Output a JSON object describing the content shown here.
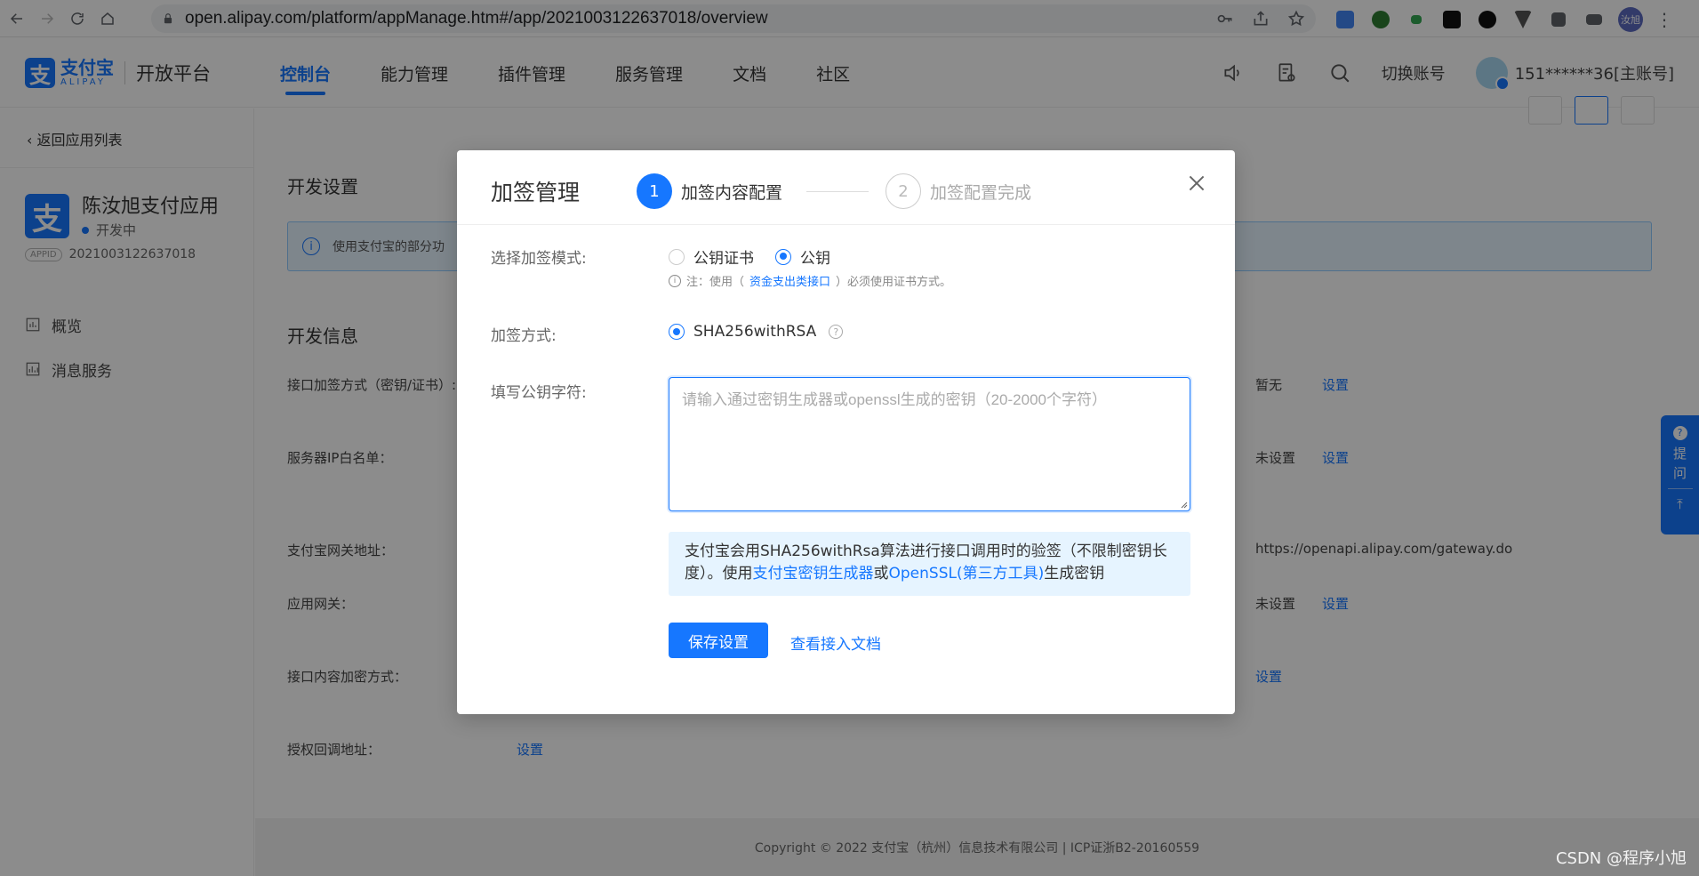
{
  "browser": {
    "url": "open.alipay.com/platform/appManage.htm#/app/2021003122637018/overview",
    "profile_initials": "汝旭"
  },
  "header": {
    "logo_cn": "支付宝",
    "logo_en": "ALIPAY",
    "platform": "开放平台",
    "nav": [
      "控制台",
      "能力管理",
      "插件管理",
      "服务管理",
      "文档",
      "社区"
    ],
    "active_nav": "控制台",
    "switch_account": "切换账号",
    "account": "151******36[主账号]"
  },
  "sidebar": {
    "back": "返回应用列表",
    "app_name": "陈汝旭支付应用",
    "app_status": "开发中",
    "appid_tag": "APPID",
    "appid": "2021003122637018",
    "menu": [
      "概览",
      "消息服务"
    ]
  },
  "main": {
    "dev_settings": "开发设置",
    "info_bar": "使用支付宝的部分功",
    "dev_info": "开发信息",
    "rows": [
      {
        "label": "接口加签方式（密钥/证书）:",
        "value": "暂无",
        "link": "设置"
      },
      {
        "label": "服务器IP白名单：",
        "value": "未设置",
        "link": "设置"
      },
      {
        "label": "支付宝网关地址：",
        "value": "https://openapi.alipay.com/gateway.do",
        "link": ""
      },
      {
        "label": "应用网关：",
        "value": "未设置",
        "link": "设置"
      },
      {
        "label": "接口内容加密方式：",
        "value": "",
        "link": "设置"
      },
      {
        "label": "授权回调地址：",
        "value": "",
        "link": "设置"
      }
    ],
    "footer": "Copyright © 2022 支付宝（杭州）信息技术有限公司  |  ICP证浙B2-20160559"
  },
  "float_help": {
    "line1": "提",
    "line2": "问"
  },
  "modal": {
    "title": "加签管理",
    "steps": [
      {
        "num": "1",
        "label": "加签内容配置"
      },
      {
        "num": "2",
        "label": "加签配置完成"
      }
    ],
    "mode_label": "选择加签模式:",
    "mode_options": [
      "公钥证书",
      "公钥"
    ],
    "mode_selected": "公钥",
    "note_prefix": "注：使用（",
    "note_link": "资金支出类接口",
    "note_suffix": "）必须使用证书方式。",
    "method_label": "加签方式:",
    "method_option": "SHA256withRSA",
    "pubkey_label": "填写公钥字符:",
    "pubkey_placeholder": "请输入通过密钥生成器或openssl生成的密钥（20-2000个字符）",
    "pubkey_value": "",
    "tip_prefix": "支付宝会用SHA256withRsa算法进行接口调用时的验签（不限制密钥长度）。使用",
    "tip_link1": "支付宝密钥生成器",
    "tip_or": "或",
    "tip_link2": "OpenSSL(第三方工具)",
    "tip_suffix": "生成密钥",
    "save_btn": "保存设置",
    "docs_link": "查看接入文档"
  },
  "watermark": "CSDN @程序小旭"
}
